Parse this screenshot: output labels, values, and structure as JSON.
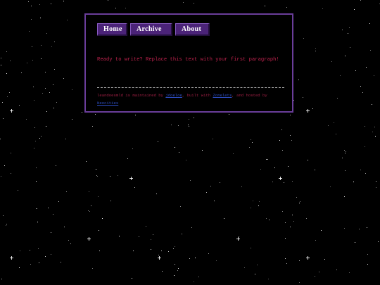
{
  "nav": {
    "items": [
      {
        "label": "Home"
      },
      {
        "label": "Archive"
      },
      {
        "label": "About"
      }
    ]
  },
  "content": {
    "intro": "Ready to write? Replace this text with your first paragraph!"
  },
  "footer": {
    "site_name": "leandoesmld",
    "text_1": " is maintained by ",
    "maintainer_link": "jdoeloe",
    "text_2": ", built with ",
    "builder_link": "Zonelets",
    "text_3": ", and hosted by ",
    "host_link": "Neocities"
  },
  "colors": {
    "page_background": "#000000",
    "panel_border": "#6a3d9a",
    "tab_background": "#4b2378",
    "text_accent": "#c0234e",
    "link": "#2d4ec4",
    "star": "#ffffff"
  }
}
